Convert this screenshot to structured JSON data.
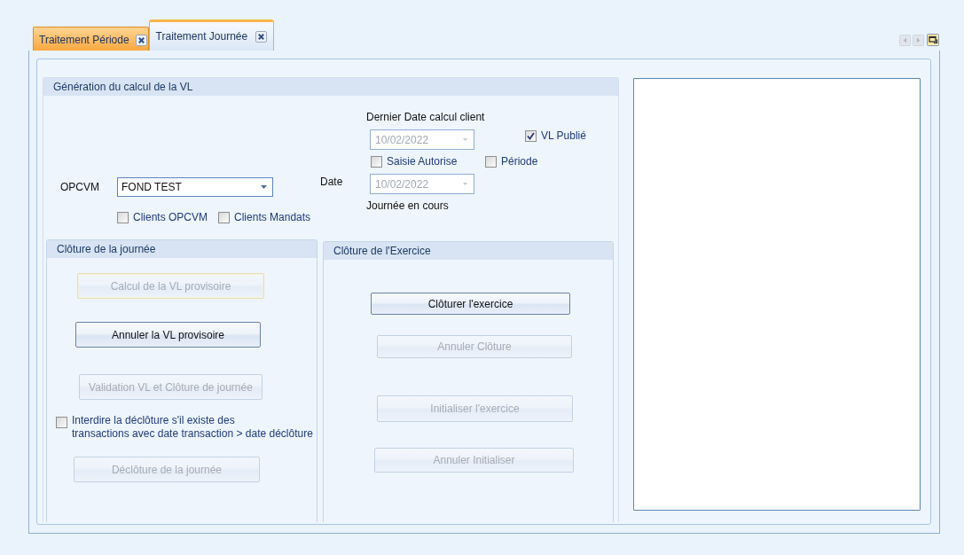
{
  "tabs": [
    {
      "label": "Traitement Période",
      "selected": false
    },
    {
      "label": "Traitement Journée",
      "selected": true
    }
  ],
  "tab_nav_buttons": [
    {
      "kind": "prev",
      "disabled": true
    },
    {
      "kind": "next",
      "disabled": true
    },
    {
      "kind": "window_list",
      "disabled": false
    }
  ],
  "generation_group": {
    "title": "Génération du calcul de la VL",
    "opcvm": {
      "label": "OPCVM",
      "value": "FOND TEST"
    },
    "client_filters": [
      {
        "label": "Clients OPCVM",
        "checked": false
      },
      {
        "label": "Clients Mandats",
        "checked": false
      }
    ],
    "last_calc_date": {
      "label": "Dernier Date calcul client",
      "value": "10/02/2022",
      "disabled": true
    },
    "vl_publie": {
      "label": "VL Publié",
      "checked": true
    },
    "options": [
      {
        "label": "Saisie Autorise",
        "checked": false
      },
      {
        "label": "Période",
        "checked": false
      }
    ],
    "date": {
      "label": "Date",
      "value": "10/02/2022",
      "disabled": true
    },
    "date_caption": "Journée en cours"
  },
  "day_closing": {
    "title": "Clôture de la journée",
    "items": [
      {
        "kind": "button",
        "label": "Calcul de la VL provisoire",
        "disabled": true,
        "focused": true
      },
      {
        "kind": "button",
        "label": "Annuler la VL provisoire",
        "disabled": false,
        "focused": false
      },
      {
        "kind": "button",
        "label": "Validation VL et Clôture de journée",
        "disabled": true,
        "focused": false
      },
      {
        "kind": "checkbox",
        "label": "Interdire la déclôture s'il existe des\ntransactions avec date transaction > date déclôture",
        "checked": false
      },
      {
        "kind": "button",
        "label": "Déclôture de la journée",
        "disabled": true,
        "focused": false
      }
    ]
  },
  "fiscal_year_closing": {
    "title": "Clôture de l'Exercice",
    "buttons": [
      {
        "label": "Clôturer l'exercice",
        "disabled": false,
        "focused": false
      },
      {
        "label": "Annuler Clôture",
        "disabled": true,
        "focused": false
      },
      {
        "label": "Initialiser l'exercice",
        "disabled": true,
        "focused": false
      },
      {
        "label": "Annuler Initialiser",
        "disabled": true,
        "focused": false
      }
    ]
  }
}
